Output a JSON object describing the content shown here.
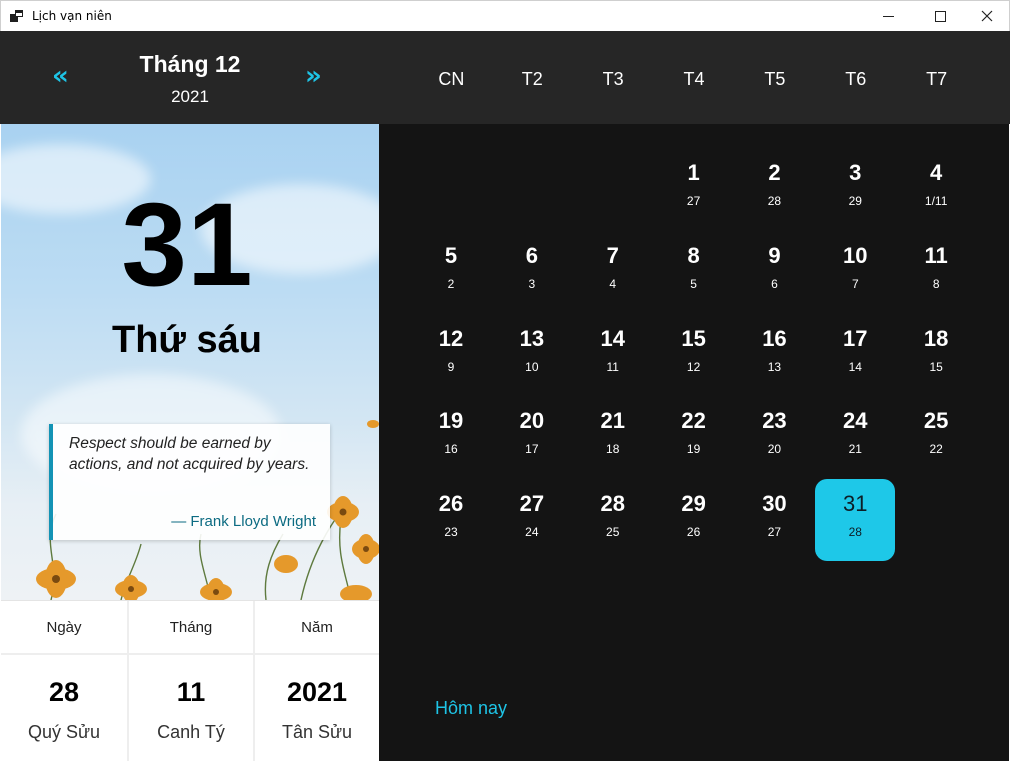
{
  "window": {
    "title": "Lịch vạn niên"
  },
  "header": {
    "prev_icon": "«",
    "next_icon": "»",
    "month_label": "Tháng 12",
    "year_label": "2021",
    "weekdays": [
      "CN",
      "T2",
      "T3",
      "T4",
      "T5",
      "T6",
      "T7"
    ]
  },
  "selected": {
    "day": "31",
    "weekday": "Thứ sáu"
  },
  "quote": {
    "text": "Respect should be earned by actions, and not acquired by years.",
    "author": "— Frank Lloyd Wright"
  },
  "lunar": {
    "columns": [
      {
        "header": "Ngày",
        "value": "28",
        "can_chi": "Quý Sửu"
      },
      {
        "header": "Tháng",
        "value": "11",
        "can_chi": "Canh Tý"
      },
      {
        "header": "Năm",
        "value": "2021",
        "can_chi": "Tân Sửu"
      }
    ]
  },
  "calendar": {
    "first_weekday_index": 3,
    "selected_day": 31,
    "days": [
      {
        "solar": "1",
        "lunar": "27"
      },
      {
        "solar": "2",
        "lunar": "28"
      },
      {
        "solar": "3",
        "lunar": "29"
      },
      {
        "solar": "4",
        "lunar": "1/11"
      },
      {
        "solar": "5",
        "lunar": "2"
      },
      {
        "solar": "6",
        "lunar": "3"
      },
      {
        "solar": "7",
        "lunar": "4"
      },
      {
        "solar": "8",
        "lunar": "5"
      },
      {
        "solar": "9",
        "lunar": "6"
      },
      {
        "solar": "10",
        "lunar": "7"
      },
      {
        "solar": "11",
        "lunar": "8"
      },
      {
        "solar": "12",
        "lunar": "9"
      },
      {
        "solar": "13",
        "lunar": "10"
      },
      {
        "solar": "14",
        "lunar": "11"
      },
      {
        "solar": "15",
        "lunar": "12"
      },
      {
        "solar": "16",
        "lunar": "13"
      },
      {
        "solar": "17",
        "lunar": "14"
      },
      {
        "solar": "18",
        "lunar": "15"
      },
      {
        "solar": "19",
        "lunar": "16"
      },
      {
        "solar": "20",
        "lunar": "17"
      },
      {
        "solar": "21",
        "lunar": "18"
      },
      {
        "solar": "22",
        "lunar": "19"
      },
      {
        "solar": "23",
        "lunar": "20"
      },
      {
        "solar": "24",
        "lunar": "21"
      },
      {
        "solar": "25",
        "lunar": "22"
      },
      {
        "solar": "26",
        "lunar": "23"
      },
      {
        "solar": "27",
        "lunar": "24"
      },
      {
        "solar": "28",
        "lunar": "25"
      },
      {
        "solar": "29",
        "lunar": "26"
      },
      {
        "solar": "30",
        "lunar": "27"
      },
      {
        "solar": "31",
        "lunar": "28"
      }
    ]
  },
  "today_label": "Hôm nay",
  "colors": {
    "accent": "#1ec4e6",
    "selected_bg": "#1ec8e8",
    "header_bg": "#262626",
    "calendar_bg": "#141414",
    "quote_border": "#1393b5",
    "quote_author": "#0c6b82"
  },
  "icons": {
    "prev": "double-chevron-left-icon",
    "next": "double-chevron-right-icon",
    "app": "calendar-app-icon"
  }
}
